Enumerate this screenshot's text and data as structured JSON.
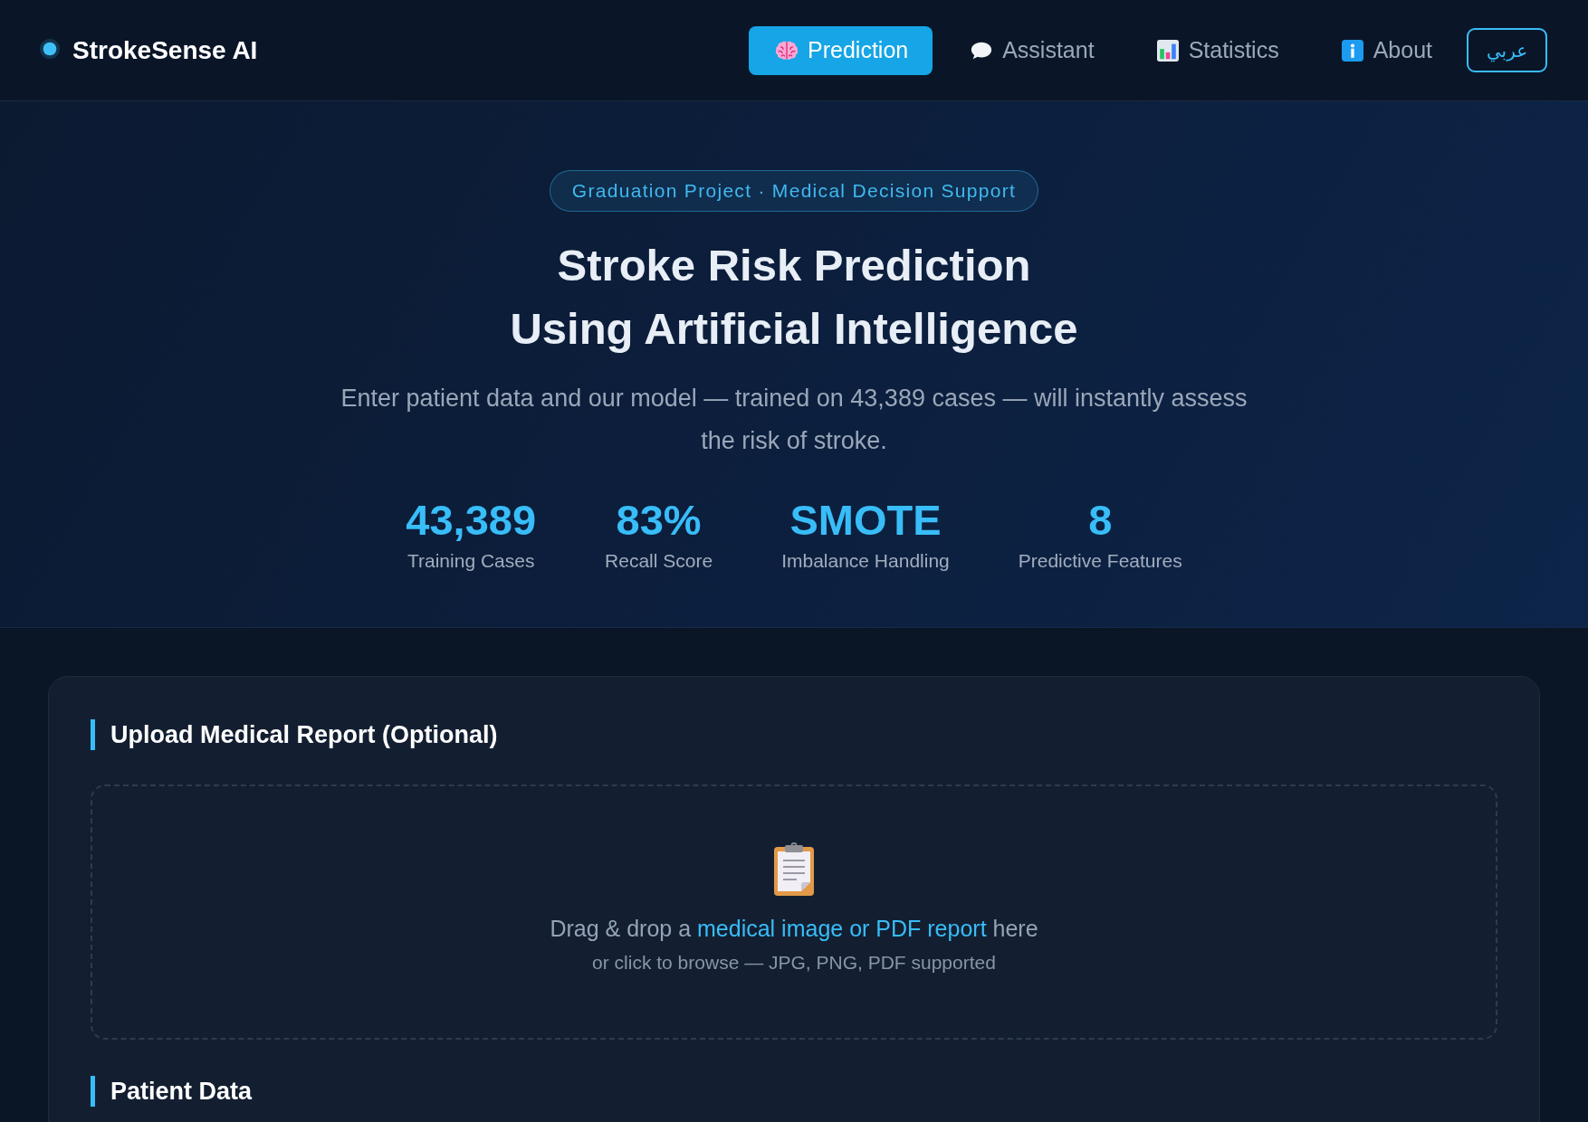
{
  "nav": {
    "brand": "StrokeSense AI",
    "tabs": [
      {
        "label": "Prediction",
        "selected": true
      },
      {
        "label": "Assistant",
        "selected": false
      },
      {
        "label": "Statistics",
        "selected": false
      },
      {
        "label": "About",
        "selected": false
      }
    ],
    "language_button": "عربي"
  },
  "hero": {
    "badge": "Graduation Project · Medical Decision Support",
    "title_lines": [
      "Stroke Risk Prediction",
      "Using Artificial Intelligence"
    ],
    "description": "Enter patient data and our model — trained on 43,389 cases — will instantly assess the risk of stroke.",
    "stats": [
      {
        "value": "43,389",
        "label": "Training Cases"
      },
      {
        "value": "83%",
        "label": "Recall Score"
      },
      {
        "value": "SMOTE",
        "label": "Imbalance Handling"
      },
      {
        "value": "8",
        "label": "Predictive Features"
      }
    ]
  },
  "form_card": {
    "upload_section": {
      "title": "Upload Medical Report (Optional)",
      "dropzone": {
        "text": "Drag & drop a **medical image or PDF report** here",
        "hint": "or click to browse — JPG, PNG, PDF supported"
      }
    },
    "patient_section": {
      "title": "Patient Data"
    }
  }
}
